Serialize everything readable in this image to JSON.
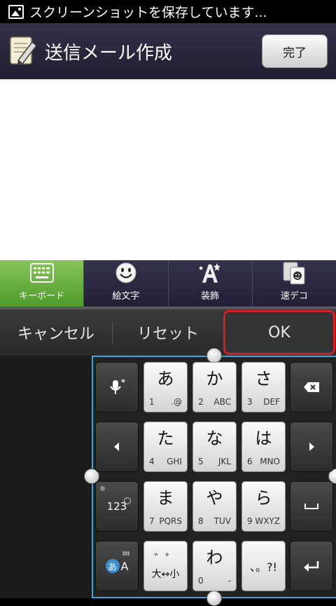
{
  "status_bar": {
    "text": "スクリーンショットを保存しています..."
  },
  "header": {
    "title": "送信メール作成",
    "done_label": "完了"
  },
  "tabs": [
    {
      "label": "キーボード",
      "active": true,
      "icon": "keyboard-icon"
    },
    {
      "label": "絵文字",
      "active": false,
      "icon": "smiley-icon"
    },
    {
      "label": "装飾",
      "active": false,
      "icon": "decoration-icon"
    },
    {
      "label": "速デコ",
      "active": false,
      "icon": "quick-deco-icon"
    }
  ],
  "actions": {
    "cancel": "キャンセル",
    "reset": "リセット",
    "ok": "OK"
  },
  "keyboard": {
    "side_keys": {
      "mode_123": "123",
      "mode_kana": "あ",
      "mode_alpha": "A"
    },
    "keys": [
      {
        "main": "あ",
        "num": "1",
        "sub": ".@"
      },
      {
        "main": "か",
        "num": "2",
        "sub": "ABC"
      },
      {
        "main": "さ",
        "num": "3",
        "sub": "DEF"
      },
      {
        "main": "た",
        "num": "4",
        "sub": "GHI"
      },
      {
        "main": "な",
        "num": "5",
        "sub": "JKL"
      },
      {
        "main": "は",
        "num": "6",
        "sub": "MNO"
      },
      {
        "main": "ま",
        "num": "7",
        "sub": "PQRS"
      },
      {
        "main": "や",
        "num": "8",
        "sub": "TUV"
      },
      {
        "main": "ら",
        "num": "9",
        "sub": "WXYZ"
      },
      {
        "main": "゛゜",
        "num": "",
        "sub": "大↔小"
      },
      {
        "main": "わ",
        "num": "0",
        "sub": "-"
      },
      {
        "main": "、。?!",
        "num": "",
        "sub": ""
      }
    ]
  },
  "colors": {
    "accent_blue": "#3aa6dd",
    "ok_border": "#d0202a",
    "active_tab": "#6fb544"
  }
}
